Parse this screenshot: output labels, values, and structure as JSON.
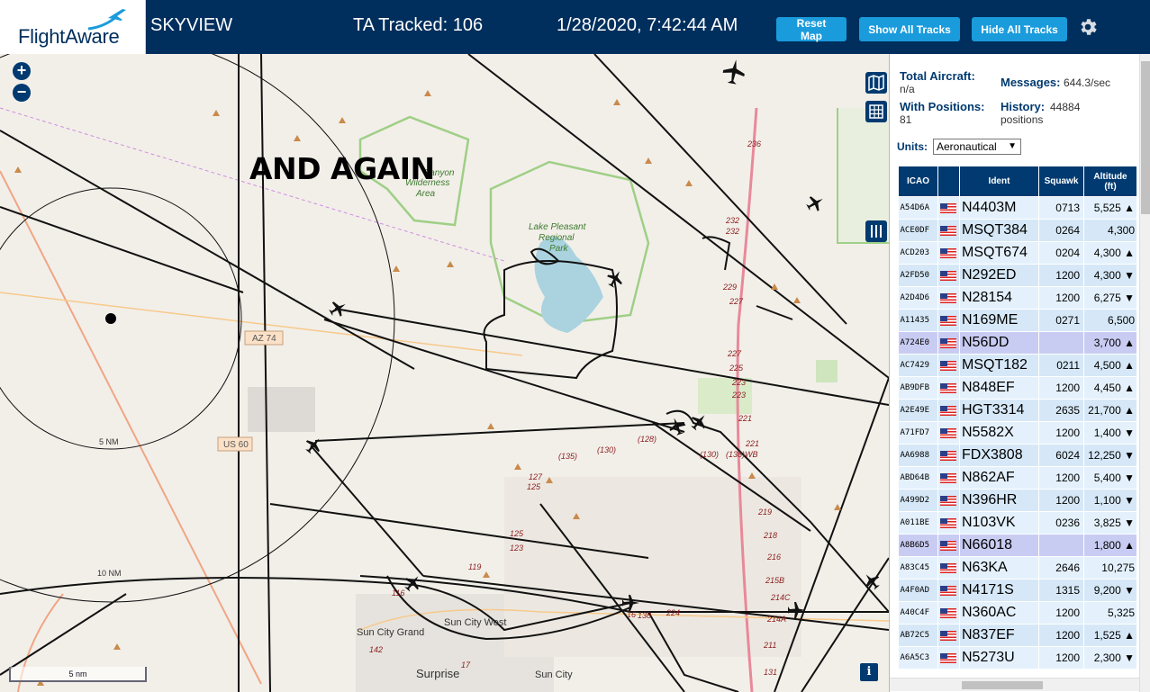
{
  "header": {
    "logo_text": "FlightAware",
    "app_name": "SKYVIEW",
    "tracked": "TA Tracked: 106",
    "clock": "1/28/2020, 7:42:44 AM",
    "buttons": {
      "reset": "Reset Map",
      "show_all": "Show All Tracks",
      "hide_all": "Hide All Tracks"
    },
    "colors": {
      "bar": "#002f5d",
      "button": "#1a9bdc"
    }
  },
  "map": {
    "annotation": "AND AGAIN",
    "zoom_in": "+",
    "zoom_out": "−",
    "scale_label": "5 nm",
    "info": "i",
    "range_rings": [
      "5 NM",
      "10 NM"
    ],
    "place_labels": {
      "canyon": "Canyon",
      "wilderness": "Wilderness",
      "area": "Area",
      "lake1": "Lake Pleasant",
      "lake2": "Regional",
      "lake3": "Park",
      "az74": "AZ 74",
      "us60": "US 60",
      "sun_city_west": "Sun City West",
      "sun_city_grand": "Sun City Grand",
      "surprise": "Surprise",
      "sun_city": "Sun City"
    },
    "route_numbers": [
      "236",
      "232",
      "232",
      "229",
      "227",
      "227",
      "225",
      "223",
      "223",
      "221",
      "221",
      "219",
      "218",
      "216",
      "215B",
      "214C",
      "214A",
      "211",
      "131",
      "(130)",
      "(135)",
      "(128)",
      "127",
      "125",
      "125",
      "123",
      "119",
      "116",
      "142",
      "17",
      "16",
      "138",
      "224",
      "(130)",
      "(138)WB"
    ]
  },
  "sidebar": {
    "total_aircraft_label": "Total Aircraft:",
    "total_aircraft_value": "n/a",
    "with_positions_label": "With Positions:",
    "with_positions_value": "81",
    "messages_label": "Messages:",
    "messages_value": "644.3/sec",
    "history_label": "History:",
    "history_value": "44884",
    "history_unit": "positions",
    "units_label": "Units:",
    "units_value": "Aeronautical",
    "table": {
      "headers": {
        "icao": "ICAO",
        "ident": "Ident",
        "squawk": "Squawk",
        "altitude": "Altitude",
        "altitude_unit": "(ft)"
      },
      "rows": [
        {
          "icao": "A54D6A",
          "ident": "N4403M",
          "squawk": "0713",
          "alt": "5,525 ▲",
          "sel": false
        },
        {
          "icao": "ACE0DF",
          "ident": "MSQT384",
          "squawk": "0264",
          "alt": "4,300",
          "sel": false
        },
        {
          "icao": "ACD203",
          "ident": "MSQT674",
          "squawk": "0204",
          "alt": "4,300 ▲",
          "sel": false
        },
        {
          "icao": "A2FD50",
          "ident": "N292ED",
          "squawk": "1200",
          "alt": "4,300 ▼",
          "sel": false
        },
        {
          "icao": "A2D4D6",
          "ident": "N28154",
          "squawk": "1200",
          "alt": "6,275 ▼",
          "sel": false
        },
        {
          "icao": "A11435",
          "ident": "N169ME",
          "squawk": "0271",
          "alt": "6,500",
          "sel": false
        },
        {
          "icao": "A724E0",
          "ident": "N56DD",
          "squawk": "",
          "alt": "3,700 ▲",
          "sel": true
        },
        {
          "icao": "AC7429",
          "ident": "MSQT182",
          "squawk": "0211",
          "alt": "4,500 ▲",
          "sel": false
        },
        {
          "icao": "AB9DFB",
          "ident": "N848EF",
          "squawk": "1200",
          "alt": "4,450 ▲",
          "sel": false
        },
        {
          "icao": "A2E49E",
          "ident": "HGT3314",
          "squawk": "2635",
          "alt": "21,700 ▲",
          "sel": false
        },
        {
          "icao": "A71FD7",
          "ident": "N5582X",
          "squawk": "1200",
          "alt": "1,400 ▼",
          "sel": false
        },
        {
          "icao": "AA6988",
          "ident": "FDX3808",
          "squawk": "6024",
          "alt": "12,250 ▼",
          "sel": false
        },
        {
          "icao": "ABD64B",
          "ident": "N862AF",
          "squawk": "1200",
          "alt": "5,400 ▼",
          "sel": false
        },
        {
          "icao": "A499D2",
          "ident": "N396HR",
          "squawk": "1200",
          "alt": "1,100 ▼",
          "sel": false
        },
        {
          "icao": "A011BE",
          "ident": "N103VK",
          "squawk": "0236",
          "alt": "3,825 ▼",
          "sel": false
        },
        {
          "icao": "A8B6D5",
          "ident": "N66018",
          "squawk": "",
          "alt": "1,800 ▲",
          "sel": true
        },
        {
          "icao": "A83C45",
          "ident": "N63KA",
          "squawk": "2646",
          "alt": "10,275",
          "sel": false
        },
        {
          "icao": "A4F0AD",
          "ident": "N4171S",
          "squawk": "1315",
          "alt": "9,200 ▼",
          "sel": false
        },
        {
          "icao": "A40C4F",
          "ident": "N360AC",
          "squawk": "1200",
          "alt": "5,325",
          "sel": false
        },
        {
          "icao": "AB72C5",
          "ident": "N837EF",
          "squawk": "1200",
          "alt": "1,525 ▲",
          "sel": false
        },
        {
          "icao": "A6A5C3",
          "ident": "N5273U",
          "squawk": "1200",
          "alt": "2,300 ▼",
          "sel": false
        }
      ]
    }
  }
}
